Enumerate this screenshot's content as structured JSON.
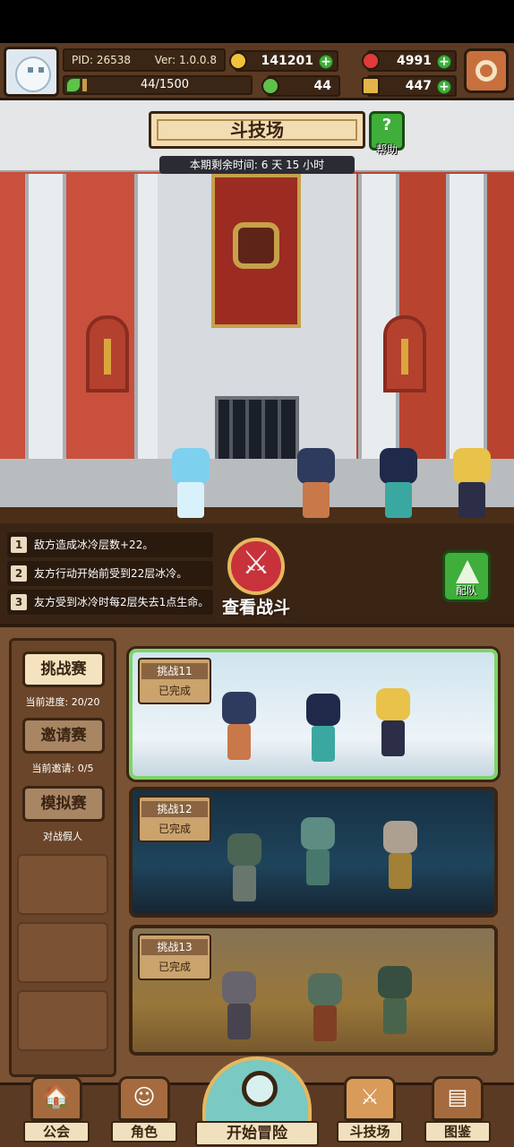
{
  "player": {
    "pid": "PID: 26538",
    "version": "Ver: 1.0.0.8",
    "xp": "44/1500",
    "xp_fraction": 0.029
  },
  "resources": {
    "gold": "141201",
    "gems": "4991",
    "clover": "44",
    "scroll": "447"
  },
  "header": {
    "title": "斗技场",
    "help_label": "帮助",
    "timer": "本期剩余时间: 6 天 15 小时"
  },
  "bonuses": [
    {
      "num": "1",
      "text": "敌方造成冰冷层数+22。"
    },
    {
      "num": "2",
      "text": "友方行动开始前受到22层冰冷。"
    },
    {
      "num": "3",
      "text": "友方受到冰冷时每2层失去1点生命。"
    }
  ],
  "actions": {
    "view_battle": "查看战斗",
    "team": "配队"
  },
  "sidebar": {
    "challenge": "挑战赛",
    "challenge_progress": "当前进度: 20/20",
    "invite": "邀请赛",
    "invite_progress": "当前邀请: 0/5",
    "simulate": "模拟赛",
    "simulate_note": "对战假人"
  },
  "challenges": [
    {
      "name": "挑战11",
      "status": "已完成"
    },
    {
      "name": "挑战12",
      "status": "已完成"
    },
    {
      "name": "挑战13",
      "status": "已完成"
    }
  ],
  "nav": {
    "guild": "公会",
    "character": "角色",
    "adventure": "开始冒险",
    "arena": "斗技场",
    "codex": "图鉴"
  },
  "colors": {
    "wood": "#5a3a22",
    "parchment": "#f1ddb3",
    "accent_green": "#3fae3a",
    "selected_border": "#7fd36a"
  }
}
